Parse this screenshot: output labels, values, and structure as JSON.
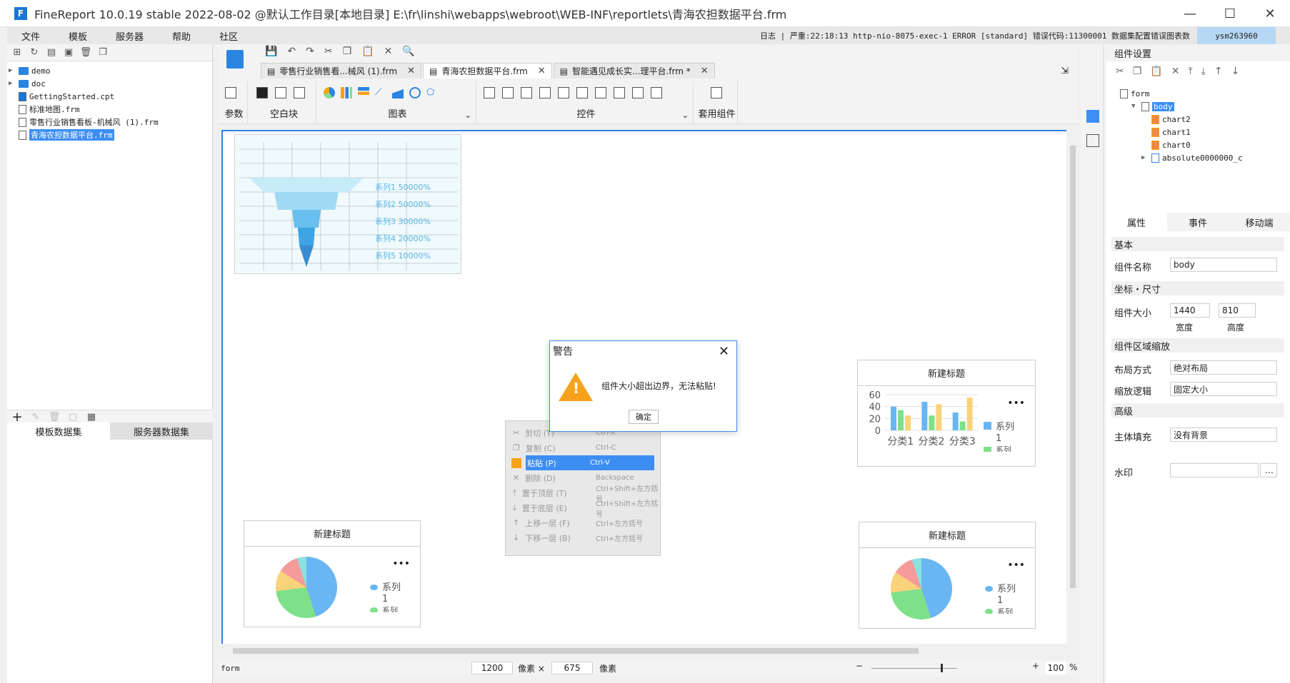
{
  "window": {
    "title": "FineReport 10.0.19 stable 2022-08-02 @默认工作目录[本地目录]    E:\\fr\\linshi\\webapps\\webroot\\WEB-INF\\reportlets\\青海农担数据平台.frm",
    "buttons": {
      "minimize": "—",
      "maximize": "☐",
      "close": "✕"
    }
  },
  "menu": {
    "items": [
      "文件",
      "模板",
      "服务器",
      "帮助",
      "社区"
    ],
    "log": "日志 | 严重:22:18:13 http-nio-8075-exec-1 ERROR [standard] 错误代码:11300001 数据集配置错误图表数",
    "user": "ysm263960"
  },
  "left": {
    "tree": [
      {
        "label": "demo",
        "type": "folder"
      },
      {
        "label": "doc",
        "type": "folder"
      },
      {
        "label": "GettingStarted.cpt",
        "type": "file"
      },
      {
        "label": "标准地图.frm",
        "type": "file"
      },
      {
        "label": "零售行业销售看板-机械风 (1).frm",
        "type": "file"
      },
      {
        "label": "青海农担数据平台.frm",
        "type": "file",
        "selected": true
      }
    ],
    "ds_tabs": [
      "模板数据集",
      "服务器数据集"
    ]
  },
  "editor": {
    "tabs": [
      {
        "label": "零售行业销售看...械风 (1).frm"
      },
      {
        "label": "青海农担数据平台.frm",
        "active": true
      },
      {
        "label": "智能遇见成长实...理平台.frm *"
      }
    ],
    "groups": [
      "参数",
      "空白块",
      "图表",
      "控件",
      "套用组件"
    ]
  },
  "canvas": {
    "funnel_labels": [
      "系列1 50000%",
      "系列2 50000%",
      "系列3 30000%",
      "系列4 20000%",
      "系列5 10000%"
    ],
    "chart_title": "新建标题",
    "bar_axis": [
      "60",
      "40",
      "20",
      "0"
    ],
    "bar_categories": [
      "分类1",
      "分类2",
      "分类3"
    ],
    "legend_series": "系列",
    "legend_num": "1",
    "legend_cut": "系列"
  },
  "chart_data": {
    "type": "bar",
    "categories": [
      "分类1",
      "分类2",
      "分类3"
    ],
    "series": [
      {
        "name": "系列1",
        "values": [
          40,
          48,
          30
        ]
      },
      {
        "values": [
          34,
          25,
          15
        ]
      },
      {
        "values": [
          25,
          44,
          55
        ]
      }
    ],
    "ylim": [
      0,
      60
    ],
    "colors": [
      "#6ab6f2",
      "#7fe08a",
      "#f9d37a"
    ]
  },
  "dialog": {
    "title": "警告",
    "message": "组件大小超出边界，无法粘贴!",
    "ok": "确定"
  },
  "context_menu": [
    {
      "label": "剪切 (T)",
      "shortcut": "Ctrl-X"
    },
    {
      "label": "复制 (C)",
      "shortcut": "Ctrl-C"
    },
    {
      "label": "粘贴 (P)",
      "shortcut": "Ctrl-V",
      "active": true
    },
    {
      "label": "删除 (D)",
      "shortcut": "Backspace"
    },
    {
      "label": "置于顶层 (T)",
      "shortcut": "Ctrl+Shift+左方括号"
    },
    {
      "label": "置于底层 (E)",
      "shortcut": "Ctrl+Shift+左方括号"
    },
    {
      "label": "上移一层 (F)",
      "shortcut": "Ctrl+左方括号"
    },
    {
      "label": "下移一层 (B)",
      "shortcut": "Ctrl+左方括号"
    }
  ],
  "status": {
    "width": "1200",
    "unit1": "像素 ×",
    "height": "675",
    "unit2": "像素",
    "zoom": "100",
    "pct": "%",
    "form": "form"
  },
  "right": {
    "title": "组件设置",
    "tree": [
      "form",
      "body",
      "chart2",
      "chart1",
      "chart0",
      "absolute0000000_c"
    ],
    "tabs": [
      "属性",
      "事件",
      "移动端"
    ],
    "sections": {
      "basic": "基本",
      "coord": "坐标・尺寸",
      "scale": "组件区域缩放",
      "adv": "高级"
    },
    "fields": {
      "name_label": "组件名称",
      "name_value": "body",
      "size_label": "组件大小",
      "width": "1440",
      "height": "810",
      "width_label": "宽度",
      "height_label": "高度",
      "layout_label": "布局方式",
      "layout_value": "绝对布局",
      "zoom_label": "缩放逻辑",
      "zoom_value": "固定大小",
      "fill_label": "主体填充",
      "fill_value": "没有背景",
      "watermark_label": "水印"
    }
  }
}
